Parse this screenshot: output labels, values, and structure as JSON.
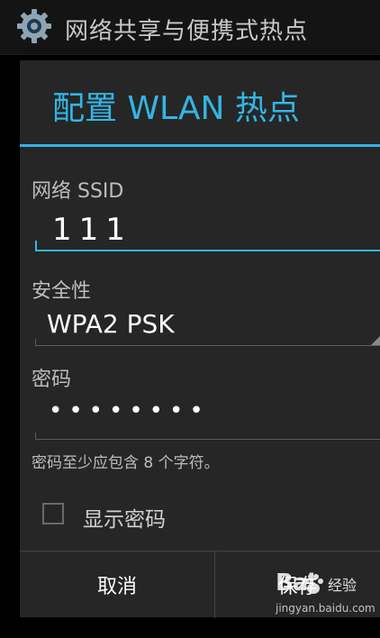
{
  "app_bar": {
    "title": "网络共享与便携式热点",
    "icon": "gear-icon"
  },
  "dialog": {
    "title": "配置 WLAN 热点",
    "ssid": {
      "label": "网络 SSID",
      "value": "111"
    },
    "security": {
      "label": "安全性",
      "value": "WPA2 PSK"
    },
    "password": {
      "label": "密码",
      "value": "••••••••",
      "hint": "密码至少应包含 8 个字符。"
    },
    "show_password": {
      "label": "显示密码",
      "checked": false
    },
    "buttons": {
      "cancel": "取消",
      "save": "保存"
    }
  },
  "watermark": {
    "logo_left": "Bai",
    "logo_right": "经验",
    "url": "jingyan.baidu.com"
  },
  "colors": {
    "accent": "#33b5e5",
    "dialog_bg": "#262626",
    "background": "#000000"
  }
}
